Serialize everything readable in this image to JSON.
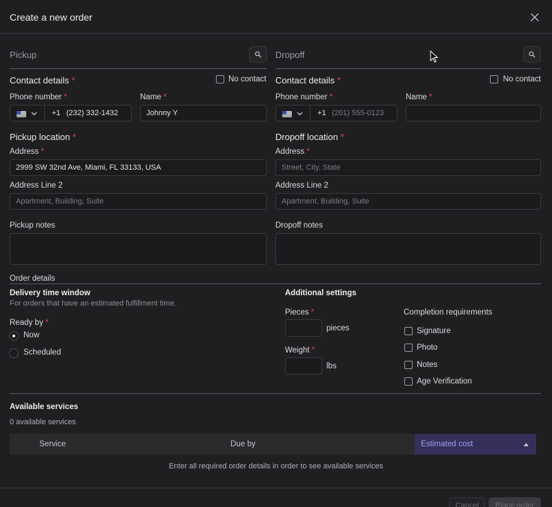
{
  "modal": {
    "title": "Create a new order"
  },
  "pickup": {
    "section_title": "Pickup",
    "contact_title": "Contact details",
    "no_contact_label": "No contact",
    "phone_label": "Phone number",
    "phone_code": "+1",
    "phone_value": "(232) 332-1432",
    "name_label": "Name",
    "name_value": "Johnny Y",
    "location_title": "Pickup location",
    "address_label": "Address",
    "address_value": "2999 SW 32nd Ave, Miami, FL 33133, USA",
    "address2_label": "Address Line 2",
    "address2_placeholder": "Apartment, Building, Suite",
    "notes_label": "Pickup notes"
  },
  "dropoff": {
    "section_title": "Dropoff",
    "contact_title": "Contact details",
    "no_contact_label": "No contact",
    "phone_label": "Phone number",
    "phone_code": "+1",
    "phone_placeholder": "(201) 555-0123",
    "name_label": "Name",
    "location_title": "Dropoff location",
    "address_label": "Address",
    "address_placeholder": "Street, City, State",
    "address2_label": "Address Line 2",
    "address2_placeholder": "Apartment, Building, Suite",
    "notes_label": "Dropoff notes"
  },
  "required_mark": "*",
  "order_details": {
    "section_title": "Order details",
    "delivery_title": "Delivery time window",
    "delivery_desc": "For orders that have an estimated fulfillment time.",
    "ready_by_label": "Ready by",
    "ready_now": "Now",
    "ready_scheduled": "Scheduled",
    "ready_selected": "Now",
    "additional_title": "Additional settings",
    "pieces_label": "Pieces",
    "pieces_unit": "pieces",
    "weight_label": "Weight",
    "weight_unit": "lbs",
    "completion_title": "Completion requirements",
    "completion_items": [
      "Signature",
      "Photo",
      "Notes",
      "Age Verification"
    ]
  },
  "services": {
    "title": "Available services",
    "count_text": "0 available services",
    "col_service": "Service",
    "col_due": "Due by",
    "col_cost": "Estimated cost",
    "empty_text": "Enter all required order details in order to see available services"
  },
  "footer": {
    "cancel_label": "Cancel",
    "place_label": "Place order"
  },
  "colors": {
    "accent": "#a99cf5",
    "required": "#e5484d",
    "background": "#1f1f21"
  }
}
